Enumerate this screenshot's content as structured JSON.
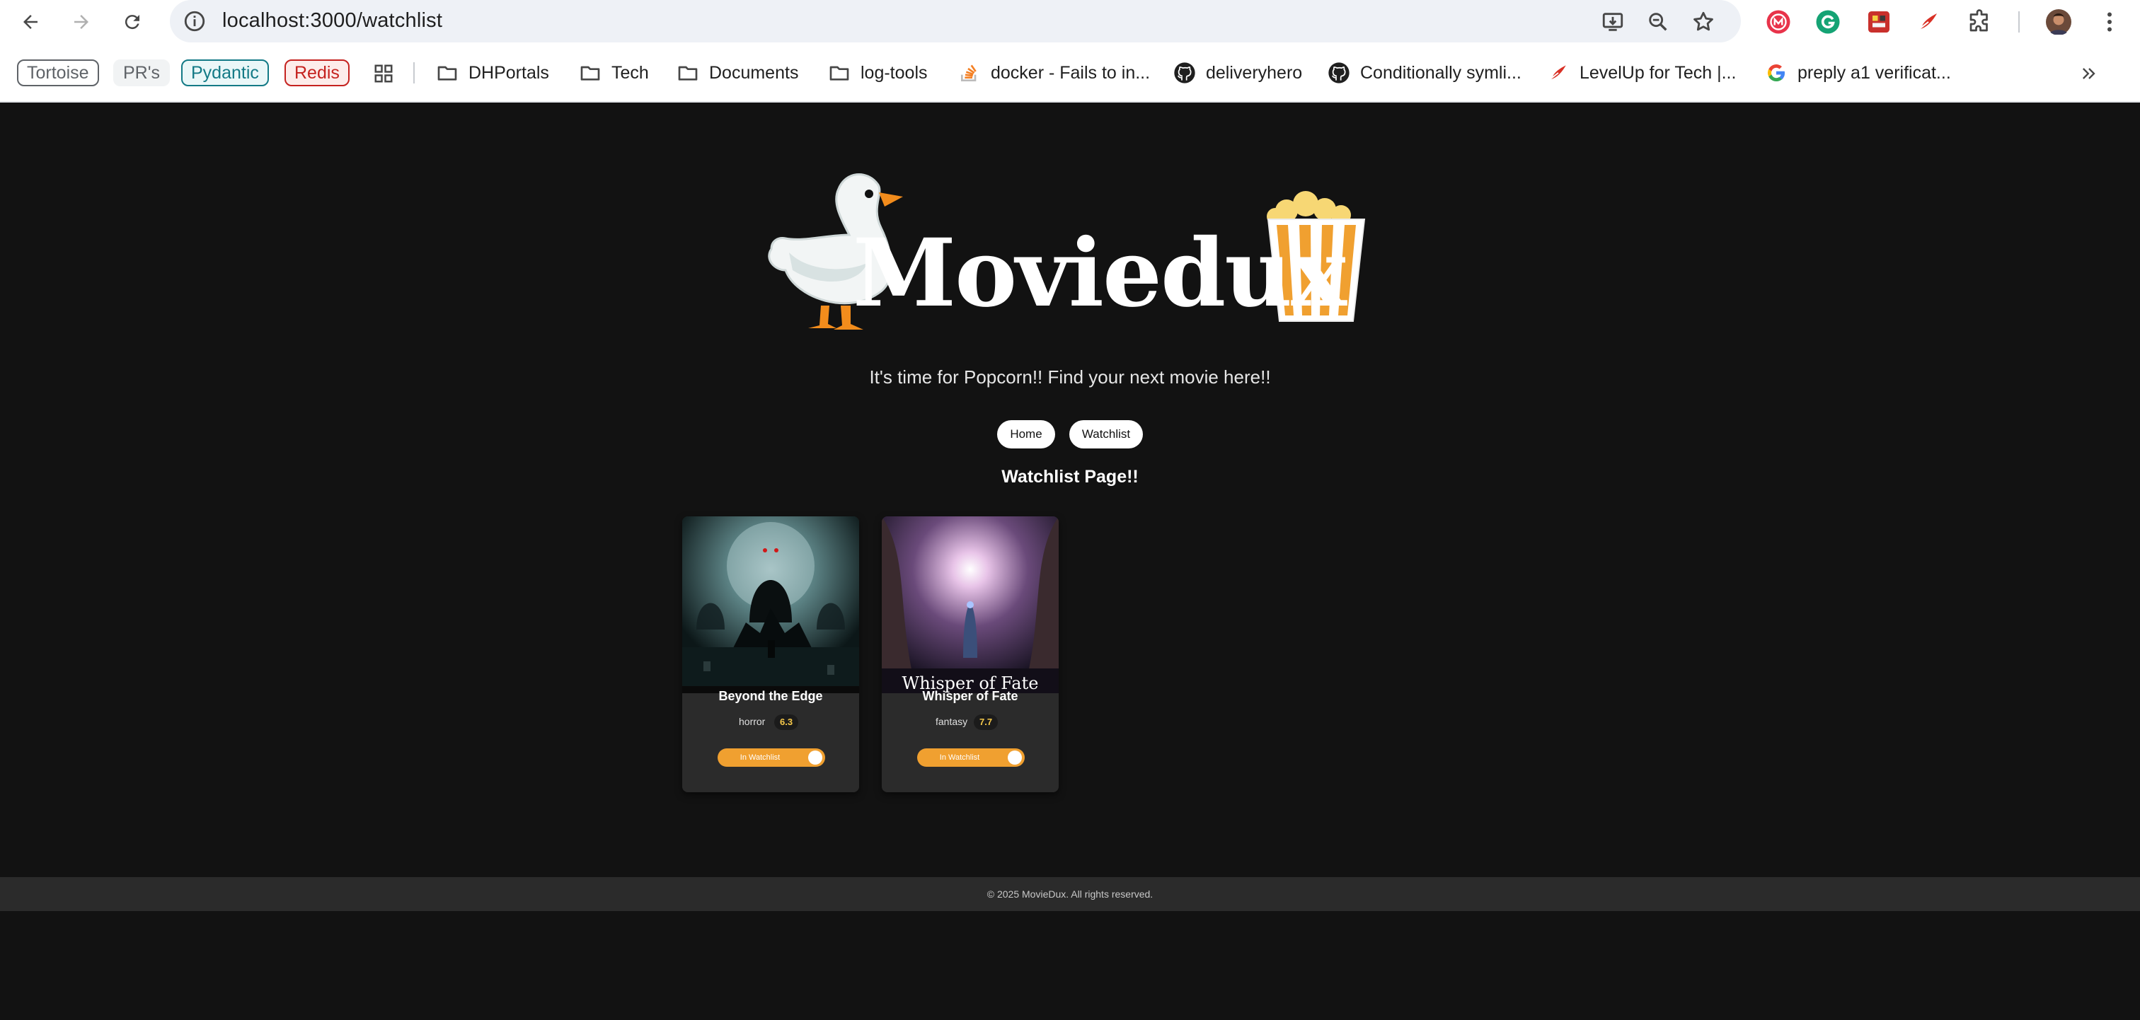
{
  "browser": {
    "url": "localhost:3000/watchlist",
    "bookmark_chips": [
      {
        "label": "Tortoise",
        "color": "#5f6368"
      },
      {
        "label": "PR's",
        "color": "#5f6368"
      },
      {
        "label": "Pydantic",
        "color": "#137a86"
      },
      {
        "label": "Redis",
        "color": "#c5221f"
      }
    ],
    "bookmarks": [
      {
        "label": "DHPortals",
        "icon": "folder-icon"
      },
      {
        "label": "Tech",
        "icon": "folder-icon"
      },
      {
        "label": "Documents",
        "icon": "folder-icon"
      },
      {
        "label": "log-tools",
        "icon": "folder-icon"
      },
      {
        "label": "docker - Fails to in...",
        "icon": "stackoverflow-icon"
      },
      {
        "label": "deliveryhero",
        "icon": "github-icon"
      },
      {
        "label": "Conditionally symli...",
        "icon": "github-icon"
      },
      {
        "label": "LevelUp for Tech |...",
        "icon": "levelup-icon"
      },
      {
        "label": "preply a1 verificat...",
        "icon": "google-icon"
      }
    ]
  },
  "app": {
    "logo_text": "Moviedux",
    "tagline": "It's time for Popcorn!! Find your next movie here!!",
    "nav": {
      "home": "Home",
      "watchlist": "Watchlist"
    },
    "heading": "Watchlist Page!!",
    "movies": [
      {
        "title": "Beyond the Edge",
        "genre": "horror",
        "rating": "6.3",
        "toggle_label": "In Watchlist",
        "in_watchlist": true
      },
      {
        "title": "Whisper of Fate",
        "genre": "fantasy",
        "rating": "7.7",
        "toggle_label": "In Watchlist",
        "in_watchlist": true
      }
    ],
    "poster_text": {
      "whisper": "Whisper of Fate"
    },
    "footer": "© 2025 MovieDux. All rights reserved."
  },
  "colors": {
    "accent": "#f0a030",
    "page_bg": "#121212",
    "card_bg": "#2b2b2b"
  }
}
